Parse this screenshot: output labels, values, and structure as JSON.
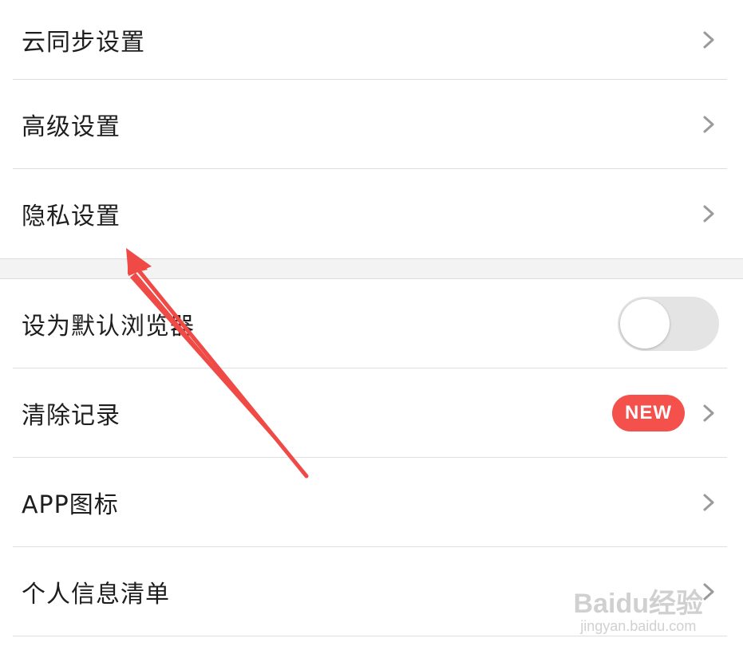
{
  "groups": [
    {
      "rows": [
        {
          "label": "云同步设置",
          "control": "chevron"
        },
        {
          "label": "高级设置",
          "control": "chevron"
        },
        {
          "label": "隐私设置",
          "control": "chevron"
        }
      ]
    },
    {
      "rows": [
        {
          "label": "设为默认浏览器",
          "control": "toggle",
          "toggle_on": false
        },
        {
          "label": "清除记录",
          "control": "chevron",
          "badge": "NEW"
        },
        {
          "label": "APP图标",
          "control": "chevron"
        },
        {
          "label": "个人信息清单",
          "control": "chevron"
        }
      ]
    }
  ],
  "icons": {
    "chevron": "chevron-right-icon",
    "annotation": "red-arrow-annotation"
  },
  "colors": {
    "badge": "#f4504c",
    "annotation_arrow": "#ef4a46",
    "toggle_off": "#e4e4e4",
    "divider": "#dedede",
    "section_gap": "#f3f3f3"
  },
  "watermark": {
    "brand": "Baidu经验",
    "url": "jingyan.baidu.com"
  }
}
